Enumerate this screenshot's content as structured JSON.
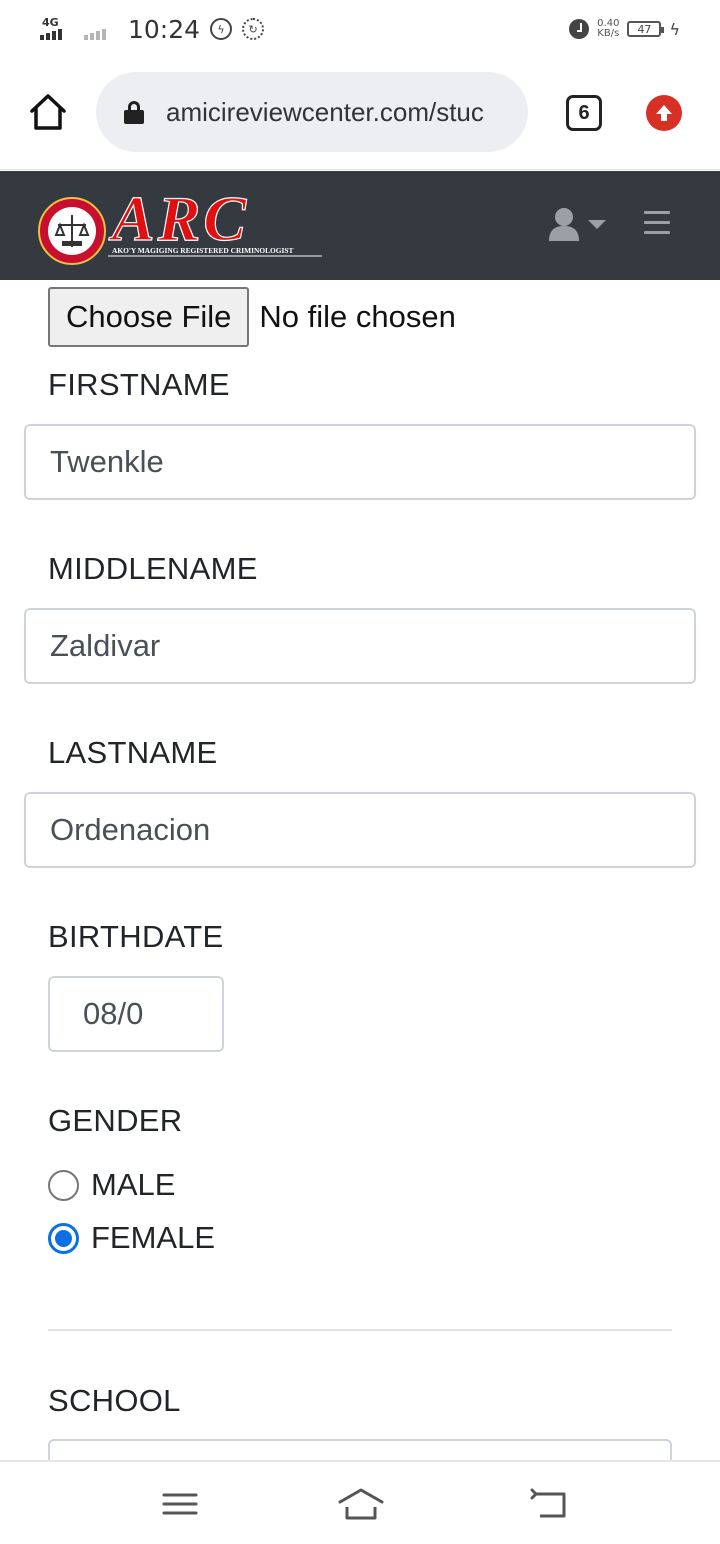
{
  "status_bar": {
    "network": "4G",
    "time": "10:24",
    "speed_value": "0.40",
    "speed_unit": "KB/s",
    "battery": "47"
  },
  "browser": {
    "url": "amicireviewcenter.com/stuc",
    "tab_count": "6",
    "update_color": "#d93025"
  },
  "site": {
    "logo_text": "ARC",
    "logo_tagline": "AKO'Y MAGIGING REGISTERED CRIMINOLOGIST",
    "navbar_color": "#343a40"
  },
  "form": {
    "file_button": "Choose File",
    "file_status": "No file chosen",
    "firstname_label": "FIRSTNAME",
    "firstname_value": "Twenkle",
    "middlename_label": "MIDDLENAME",
    "middlename_value": "Zaldivar",
    "lastname_label": "LASTNAME",
    "lastname_value": "Ordenacion",
    "birthdate_label": "BIRTHDATE",
    "birthdate_value": "08/0",
    "gender_label": "GENDER",
    "gender_options": [
      {
        "label": "MALE",
        "checked": false
      },
      {
        "label": "FEMALE",
        "checked": true
      }
    ],
    "school_label": "SCHOOL",
    "school_value": ""
  }
}
